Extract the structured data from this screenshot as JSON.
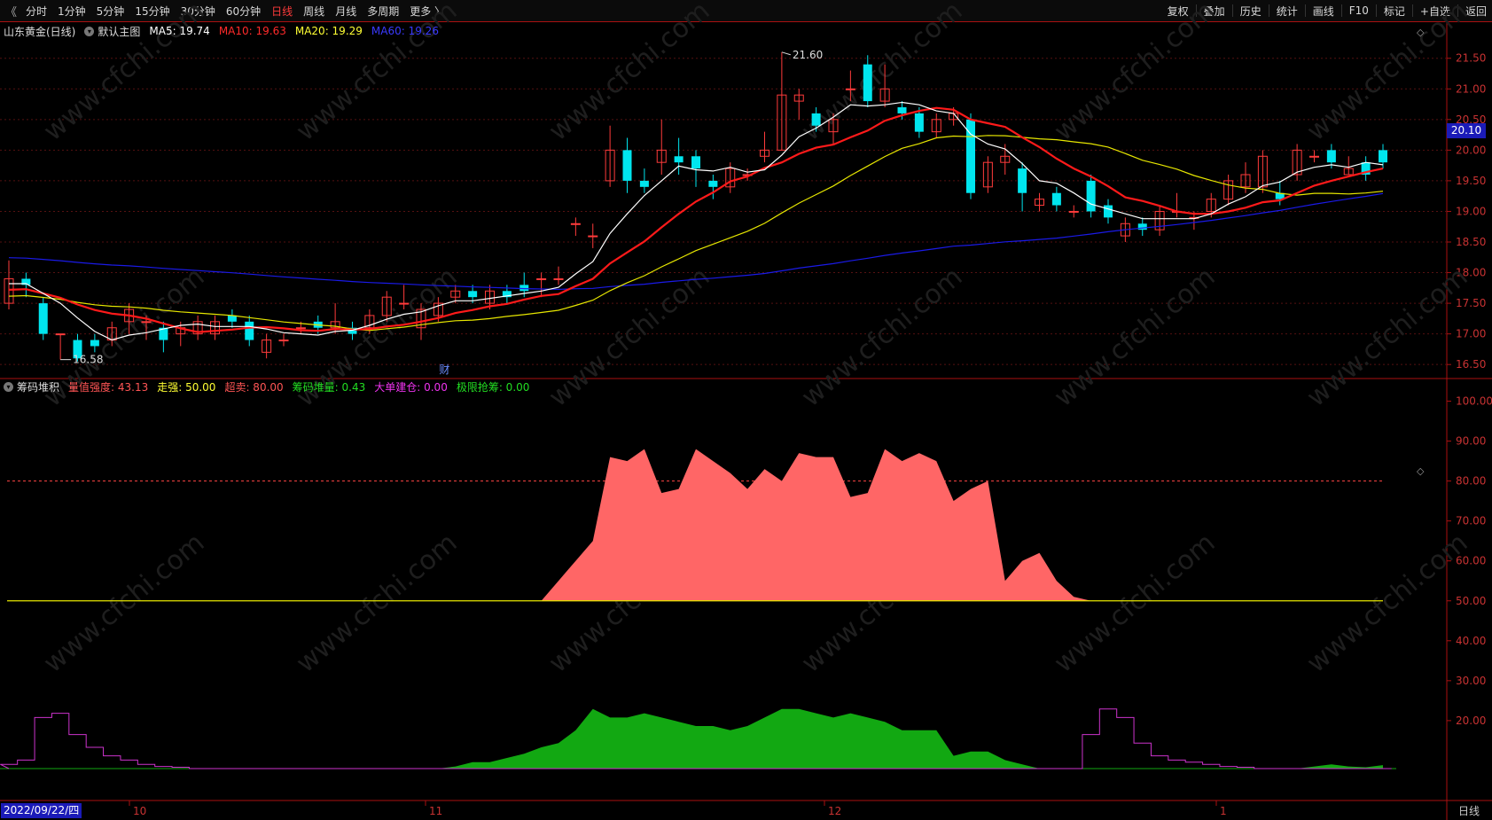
{
  "toolbar": {
    "left": [
      "分时",
      "1分钟",
      "5分钟",
      "15分钟",
      "30分钟",
      "60分钟",
      "日线",
      "周线",
      "月线",
      "多周期",
      "更多 〉"
    ],
    "active_index": 6,
    "right": [
      "复权",
      "叠加",
      "历史",
      "统计",
      "画线",
      "F10",
      "标记",
      "+自选",
      "返回"
    ]
  },
  "main_legend": {
    "stock": "山东黄金(日线)",
    "template": "默认主图",
    "ma5": "MA5: 19.74",
    "ma10": "MA10: 19.63",
    "ma20": "MA20: 19.29",
    "ma60": "MA60: 19.26"
  },
  "sub_legend": {
    "name": "筹码堆积",
    "i1": "量值强度: 43.13",
    "i2": "走强: 50.00",
    "i3": "超卖: 80.00",
    "i4": "筹码堆量: 0.43",
    "i5": "大单建仓: 0.00",
    "i6": "极限抢筹: 0.00"
  },
  "current_price": "20.10",
  "cursor_date": "2022/09/22/四",
  "corner_label": "日线",
  "colors": {
    "up": "#ff3b3b",
    "down": "#00e5ee",
    "ma5": "#ffffff",
    "ma10": "#ff1a1a",
    "ma20": "#e6e600",
    "ma60": "#1a1ae6",
    "strength_fill": "#ff6666",
    "volume_fill": "#12a812",
    "magenta": "#cc33cc"
  },
  "chart_data": [
    {
      "type": "candlestick",
      "title": "山东黄金(日线)",
      "ylim": [
        16.3,
        21.8
      ],
      "y_ticks": [
        "21.50",
        "21.00",
        "20.50",
        "20.00",
        "19.50",
        "19.00",
        "18.50",
        "18.00",
        "17.50",
        "17.00",
        "16.50"
      ],
      "x_ticks": [
        "10",
        "11",
        "12",
        "1"
      ],
      "annotations": {
        "high": "21.60",
        "low": "16.58",
        "marker": "财"
      },
      "candles": [
        [
          17.5,
          17.9,
          18.2,
          17.4
        ],
        [
          17.9,
          17.8,
          18.0,
          17.6
        ],
        [
          17.5,
          17.0,
          17.6,
          16.9
        ],
        [
          17.0,
          17.0,
          17.0,
          16.58
        ],
        [
          16.9,
          16.6,
          17.0,
          16.55
        ],
        [
          16.9,
          16.8,
          17.0,
          16.7
        ],
        [
          16.9,
          17.1,
          17.2,
          16.8
        ],
        [
          17.2,
          17.4,
          17.5,
          17.0
        ],
        [
          17.2,
          17.2,
          17.3,
          16.9
        ],
        [
          17.1,
          16.9,
          17.2,
          16.7
        ],
        [
          17.0,
          17.1,
          17.2,
          16.8
        ],
        [
          17.0,
          17.2,
          17.3,
          16.9
        ],
        [
          17.0,
          17.2,
          17.3,
          16.9
        ],
        [
          17.3,
          17.2,
          17.4,
          17.1
        ],
        [
          17.2,
          16.9,
          17.3,
          16.8
        ],
        [
          16.7,
          16.9,
          17.0,
          16.6
        ],
        [
          16.9,
          16.9,
          17.0,
          16.8
        ],
        [
          17.1,
          17.1,
          17.2,
          17.0
        ],
        [
          17.2,
          17.1,
          17.3,
          17.0
        ],
        [
          17.1,
          17.2,
          17.5,
          17.0
        ],
        [
          17.1,
          17.0,
          17.2,
          16.9
        ],
        [
          17.1,
          17.3,
          17.4,
          17.0
        ],
        [
          17.3,
          17.6,
          17.7,
          17.2
        ],
        [
          17.5,
          17.5,
          17.8,
          17.4
        ],
        [
          17.1,
          17.4,
          17.5,
          16.9
        ],
        [
          17.3,
          17.5,
          17.6,
          17.2
        ],
        [
          17.6,
          17.7,
          17.8,
          17.5
        ],
        [
          17.7,
          17.6,
          17.8,
          17.5
        ],
        [
          17.5,
          17.7,
          17.8,
          17.4
        ],
        [
          17.7,
          17.6,
          17.8,
          17.5
        ],
        [
          17.8,
          17.7,
          18.0,
          17.6
        ],
        [
          17.9,
          17.9,
          18.0,
          17.6
        ],
        [
          17.9,
          17.9,
          18.1,
          17.8
        ],
        [
          18.8,
          18.8,
          18.9,
          18.6
        ],
        [
          18.6,
          18.6,
          18.8,
          18.4
        ],
        [
          19.5,
          20.0,
          20.4,
          19.4
        ],
        [
          20.0,
          19.5,
          20.2,
          19.3
        ],
        [
          19.5,
          19.4,
          19.7,
          19.3
        ],
        [
          19.8,
          20.0,
          20.5,
          19.6
        ],
        [
          19.9,
          19.8,
          20.2,
          19.6
        ],
        [
          19.9,
          19.7,
          20.0,
          19.4
        ],
        [
          19.5,
          19.4,
          19.6,
          19.2
        ],
        [
          19.4,
          19.7,
          19.8,
          19.3
        ],
        [
          19.6,
          19.6,
          19.7,
          19.5
        ],
        [
          19.9,
          20.0,
          20.3,
          19.8
        ],
        [
          20.0,
          20.9,
          21.6,
          20.0
        ],
        [
          20.8,
          20.9,
          21.0,
          20.5
        ],
        [
          20.6,
          20.4,
          20.7,
          20.3
        ],
        [
          20.3,
          20.5,
          20.6,
          20.1
        ],
        [
          21.0,
          21.0,
          21.3,
          20.8
        ],
        [
          21.4,
          20.8,
          21.55,
          20.7
        ],
        [
          20.8,
          21.0,
          21.4,
          20.7
        ],
        [
          20.7,
          20.6,
          20.8,
          20.5
        ],
        [
          20.6,
          20.3,
          20.7,
          20.2
        ],
        [
          20.3,
          20.5,
          20.6,
          20.2
        ],
        [
          20.5,
          20.6,
          20.7,
          20.4
        ],
        [
          20.5,
          19.3,
          20.6,
          19.2
        ],
        [
          19.4,
          19.8,
          19.9,
          19.3
        ],
        [
          19.8,
          19.9,
          20.1,
          19.6
        ],
        [
          19.7,
          19.3,
          19.8,
          19.0
        ],
        [
          19.1,
          19.2,
          19.3,
          19.0
        ],
        [
          19.3,
          19.1,
          19.4,
          19.0
        ],
        [
          19.0,
          19.0,
          19.1,
          18.9
        ],
        [
          19.5,
          19.0,
          19.6,
          18.9
        ],
        [
          19.1,
          18.9,
          19.2,
          18.8
        ],
        [
          18.6,
          18.8,
          18.9,
          18.5
        ],
        [
          18.8,
          18.7,
          18.9,
          18.6
        ],
        [
          18.7,
          19.0,
          19.1,
          18.6
        ],
        [
          19.0,
          19.0,
          19.3,
          18.9
        ],
        [
          18.9,
          18.9,
          19.0,
          18.7
        ],
        [
          19.0,
          19.2,
          19.3,
          18.9
        ],
        [
          19.2,
          19.5,
          19.6,
          19.1
        ],
        [
          19.4,
          19.6,
          19.8,
          19.3
        ],
        [
          19.4,
          19.9,
          20.0,
          19.3
        ],
        [
          19.3,
          19.2,
          19.5,
          19.1
        ],
        [
          19.6,
          20.0,
          20.1,
          19.5
        ],
        [
          19.9,
          19.9,
          20.0,
          19.8
        ],
        [
          20.0,
          19.8,
          20.1,
          19.7
        ],
        [
          19.6,
          19.7,
          19.9,
          19.6
        ],
        [
          19.8,
          19.6,
          19.9,
          19.5
        ],
        [
          20.0,
          19.8,
          20.1,
          19.7
        ]
      ]
    },
    {
      "type": "area",
      "title": "筹码堆积",
      "ylim": [
        0,
        105
      ],
      "y_ticks": [
        "100.00",
        "90.00",
        "80.00",
        "70.00",
        "60.00",
        "50.00",
        "40.00",
        "30.00",
        "20.00"
      ],
      "reference_lines": [
        50,
        80
      ],
      "strength": [
        0,
        0,
        0,
        0,
        0,
        0,
        0,
        0,
        0,
        0,
        0,
        0,
        0,
        0,
        0,
        0,
        0,
        0,
        0,
        0,
        0,
        0,
        0,
        0,
        0,
        0,
        0,
        0,
        0,
        0,
        0,
        50,
        55,
        60,
        65,
        86,
        85,
        88,
        77,
        78,
        88,
        85,
        82,
        78,
        83,
        80,
        87,
        86,
        86,
        76,
        77,
        88,
        85,
        87,
        85,
        75,
        78,
        80,
        55,
        60,
        62,
        55,
        51,
        50,
        0,
        0,
        0,
        0,
        0,
        0,
        0,
        0,
        0,
        0,
        0,
        0,
        0,
        0,
        0,
        0,
        0
      ],
      "volume_area": [
        0,
        0,
        0,
        0,
        0,
        0,
        0,
        0,
        0,
        0,
        0,
        0,
        0,
        0,
        0,
        0,
        0,
        0,
        0,
        0,
        0,
        0,
        0,
        0,
        0,
        0,
        0.5,
        1.5,
        1.5,
        2.5,
        3.5,
        5,
        6,
        9,
        14,
        12,
        12,
        13,
        12,
        11,
        10,
        10,
        9,
        10,
        12,
        14,
        14,
        13,
        12,
        13,
        12,
        11,
        9,
        9,
        9,
        3,
        4,
        4,
        2,
        1,
        0,
        0,
        0,
        0,
        0,
        0,
        0,
        0,
        0,
        0,
        0,
        0,
        0,
        0,
        0,
        0,
        0.5,
        1,
        0.5,
        0.3,
        0.8
      ],
      "magenta_steps": [
        1,
        2,
        12,
        13,
        8,
        5,
        3,
        2,
        1,
        0.5,
        0.3,
        0,
        0,
        0,
        0,
        0,
        0,
        0,
        0,
        0,
        0,
        0,
        0,
        0,
        0,
        0,
        0,
        0,
        0,
        0,
        0,
        0,
        0,
        0,
        0,
        0,
        0,
        0,
        0,
        0,
        0,
        0,
        0,
        0,
        0,
        0,
        0,
        0,
        0,
        0,
        0,
        0,
        0,
        0,
        0,
        0,
        0,
        0,
        0,
        0,
        0,
        0,
        0,
        8,
        14,
        12,
        6,
        3,
        2,
        1.5,
        1,
        0.5,
        0.3,
        0,
        0,
        0,
        0,
        0,
        0,
        0,
        0
      ]
    }
  ]
}
